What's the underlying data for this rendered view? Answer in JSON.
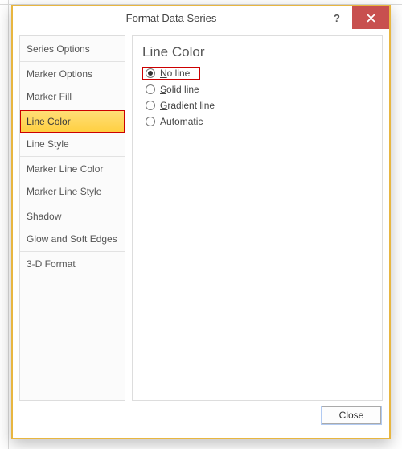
{
  "window": {
    "title": "Format Data Series"
  },
  "sidebar": {
    "groups": [
      [
        "Series Options"
      ],
      [
        "Marker Options",
        "Marker Fill"
      ],
      [
        "Line Color",
        "Line Style"
      ],
      [
        "Marker Line Color",
        "Marker Line Style"
      ],
      [
        "Shadow",
        "Glow and Soft Edges"
      ],
      [
        "3-D Format"
      ]
    ],
    "selected": "Line Color"
  },
  "panel": {
    "heading": "Line Color",
    "options": [
      {
        "key": "no_line",
        "label_pre": "",
        "label_u": "N",
        "label_post": "o line",
        "checked": true
      },
      {
        "key": "solid",
        "label_pre": "",
        "label_u": "S",
        "label_post": "olid line",
        "checked": false
      },
      {
        "key": "gradient",
        "label_pre": "",
        "label_u": "G",
        "label_post": "radient line",
        "checked": false
      },
      {
        "key": "automatic",
        "label_pre": "",
        "label_u": "A",
        "label_post": "utomatic",
        "checked": false
      }
    ]
  },
  "footer": {
    "close_label": "Close"
  },
  "colors": {
    "accent": "#e8b640",
    "close_red": "#c8504f"
  }
}
